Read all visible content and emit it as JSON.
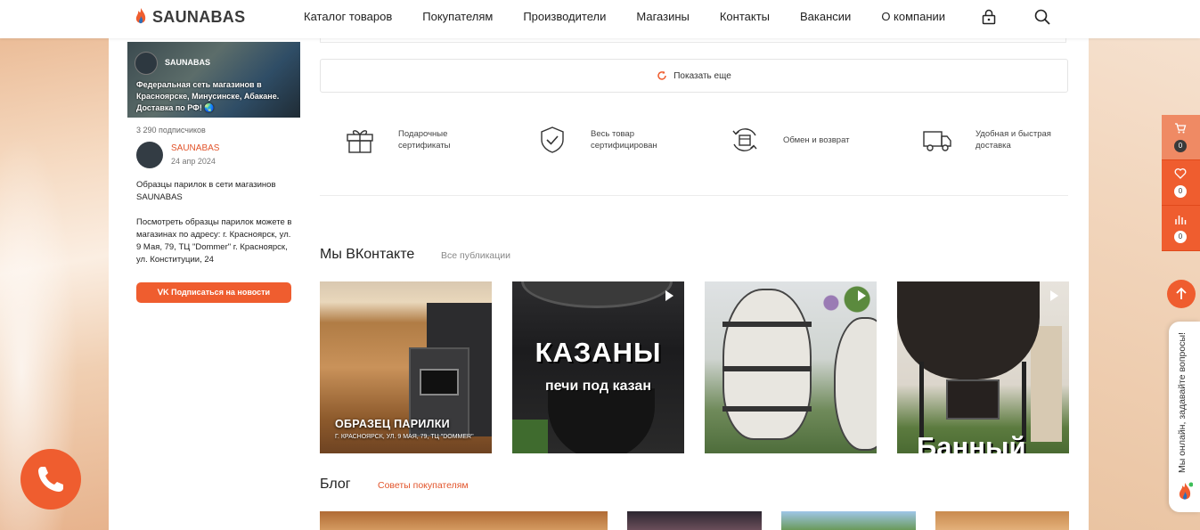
{
  "brand": {
    "logo_text": "SAUNABAS",
    "accent": "#ef5d2f"
  },
  "nav": {
    "items": [
      "Каталог товаров",
      "Покупателям",
      "Производители",
      "Магазины",
      "Контакты",
      "Вакансии",
      "О компании"
    ],
    "icons": [
      "lock-icon",
      "search-icon"
    ]
  },
  "vk_widget": {
    "banner_name": "SAUNABAS",
    "banner_text": "Федеральная сеть магазинов в Красноярске, Минусинске, Абакане. Доставка по РФ! 🌏",
    "subscribers": "3 290 подписчиков",
    "author": "SAUNABAS",
    "date": "24 апр 2024",
    "post_p1": "Образцы парилок в сети магазинов SAUNABAS",
    "post_p2": "Посмотреть образцы парилок можете в магазинах по адресу: г. Красноярск, ул. 9 Мая, 79, ТЦ \"Dommer\" г. Красноярск, ул. Конституции, 24",
    "subscribe_button": "Подписаться на новости"
  },
  "main": {
    "show_more": "Показать еще",
    "features": [
      {
        "icon": "gift-icon",
        "text": "Подарочные сертификаты"
      },
      {
        "icon": "shield-check-icon",
        "text": "Весь товар сертифицирован"
      },
      {
        "icon": "exchange-box-icon",
        "text": "Обмен и возврат"
      },
      {
        "icon": "delivery-truck-icon",
        "text": "Удобная и быстрая доставка"
      }
    ],
    "vk_section": {
      "title": "Мы ВКонтакте",
      "link": "Все публикации",
      "cards": [
        {
          "title": "ОБРАЗЕЦ ПАРИЛКИ",
          "subtitle": "Г. КРАСНОЯРСК, УЛ. 9 МАЯ, 79, ТЦ \"DOMMER\""
        },
        {
          "title": "КАЗАНЫ",
          "subtitle": "печи под казан"
        },
        {
          "title": "",
          "subtitle": ""
        },
        {
          "title": "Банный",
          "subtitle": ""
        }
      ]
    },
    "blog_section": {
      "title": "Блог",
      "link": "Советы покупателям"
    }
  },
  "side_panel": {
    "cart_count": "0",
    "favorites_count": "0",
    "compare_count": "0",
    "chat_text": "Мы онлайн, задавайте вопросы!"
  }
}
